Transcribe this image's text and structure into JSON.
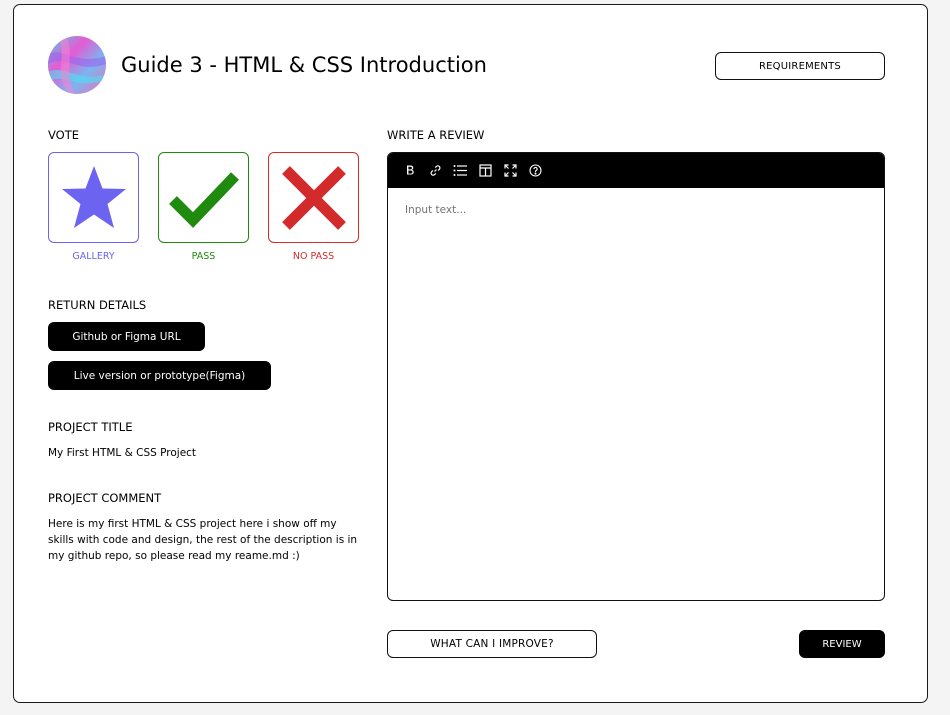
{
  "header": {
    "title": "Guide 3 - HTML & CSS Introduction",
    "requirements_label": "REQUIREMENTS"
  },
  "vote": {
    "label": "VOTE",
    "options": [
      {
        "label": "GALLERY",
        "color": "#6c63f0",
        "icon": "star-icon"
      },
      {
        "label": "PASS",
        "color": "#1f8a0e",
        "icon": "checkmark-icon"
      },
      {
        "label": "NO PASS",
        "color": "#d32b2b",
        "icon": "x-icon"
      }
    ]
  },
  "return_details": {
    "label": "RETURN DETAILS",
    "github_button": "Github or Figma URL",
    "live_button": "Live version or prototype(Figma)"
  },
  "project_title": {
    "label": "PROJECT TITLE",
    "value": "My First HTML & CSS Project"
  },
  "project_comment": {
    "label": "PROJECT COMMENT",
    "value": "Here is my first HTML & CSS project here i show off my skills with code and design, the rest of  the description is in my github repo, so please read my reame.md :)"
  },
  "review": {
    "label": "WRITE A REVIEW",
    "placeholder": "Input text...",
    "toolbar": [
      "bold-icon",
      "link-icon",
      "list-icon",
      "columns-icon",
      "fullscreen-icon",
      "help-icon"
    ]
  },
  "footer": {
    "improve_button": "WHAT CAN I IMPROVE?",
    "review_button": "REVIEW"
  }
}
